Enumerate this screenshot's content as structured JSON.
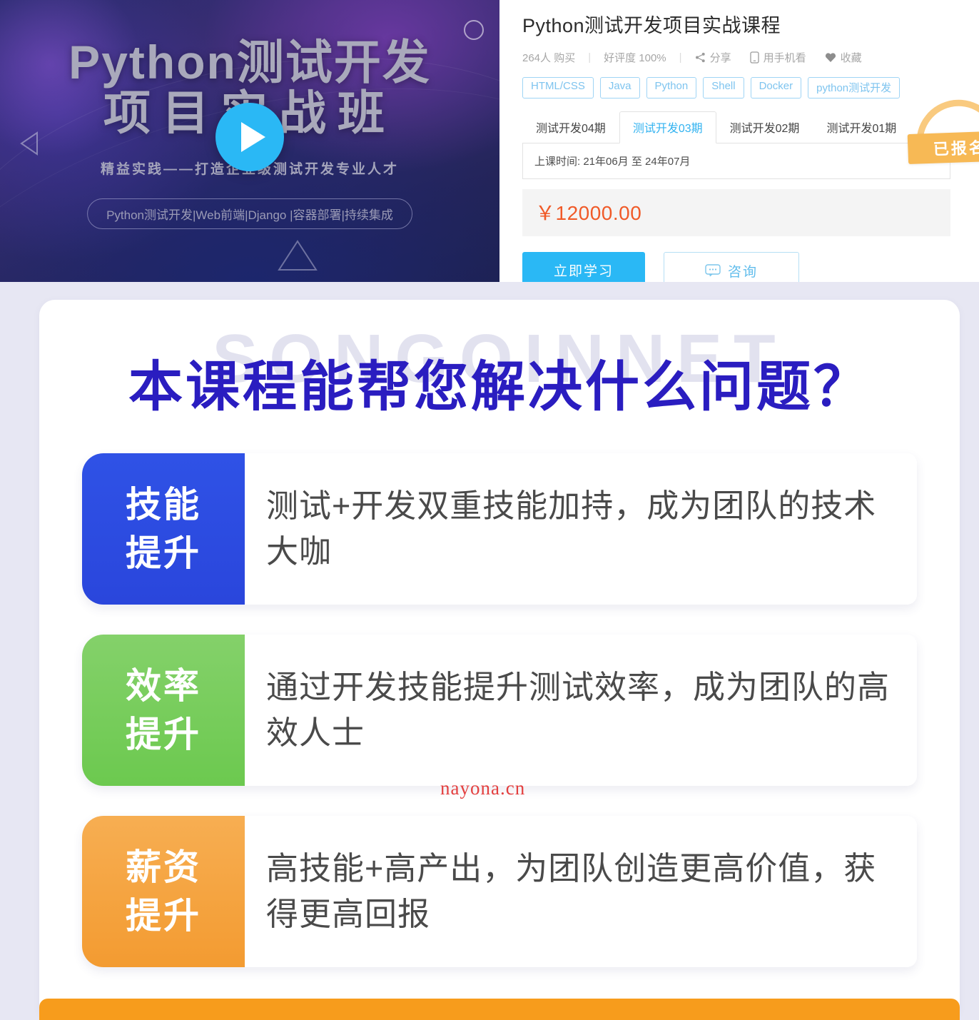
{
  "video": {
    "title_line1": "Python测试开发",
    "title_line2": "项目实战班",
    "subtitle": "精益实践——打造企业级测试开发专业人才",
    "keywords_pill": "Python测试开发|Web前端|Django |容器部署|持续集成",
    "play_icon": "play-icon",
    "accent_color": "#2ab8f5"
  },
  "course": {
    "title": "Python测试开发项目实战课程",
    "meta": {
      "purchases": "264人 购买",
      "rating": "好评度 100%",
      "share": "分享",
      "mobile": "用手机看",
      "favorite": "收藏",
      "separator": "|"
    },
    "tags": [
      "HTML/CSS",
      "Java",
      "Python",
      "Shell",
      "Docker",
      "python测试开发"
    ],
    "tabs": [
      {
        "label": "测试开发04期",
        "active": false
      },
      {
        "label": "测试开发03期",
        "active": true
      },
      {
        "label": "测试开发02期",
        "active": false
      },
      {
        "label": "测试开发01期",
        "active": false
      }
    ],
    "schedule": "上课时间: 21年06月 至 24年07月",
    "price": "￥12000.00",
    "price_color": "#f05a28",
    "buttons": {
      "primary": "立即学习",
      "secondary": "咨询"
    },
    "stamp": "已报名"
  },
  "promo": {
    "watermark": "SONGOINNET",
    "heading": "本课程能帮您解决什么问题？",
    "heading_color": "#2a1dc0",
    "red_watermark": "nayona.cn",
    "cards": [
      {
        "label_line1": "技能",
        "label_line2": "提升",
        "text": "测试+开发双重技能加持，成为团队的技术大咖",
        "color": "#2f52e6"
      },
      {
        "label_line1": "效率",
        "label_line2": "提升",
        "text": "通过开发技能提升测试效率，成为团队的高效人士",
        "color": "#6cc94f"
      },
      {
        "label_line1": "薪资",
        "label_line2": "提升",
        "text": "高技能+高产出，为团队创造更高价值，获得更高回报",
        "color": "#f39b31"
      }
    ]
  }
}
